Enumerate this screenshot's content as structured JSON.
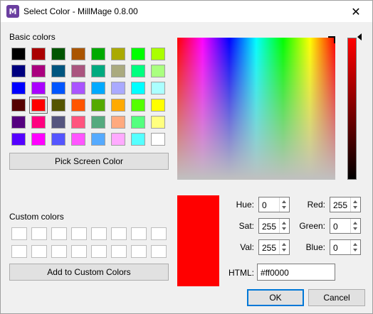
{
  "window": {
    "title": "Select Color - MillMage 0.8.00",
    "app_icon": "millmage-logo-icon",
    "close_glyph": "✕"
  },
  "basic": {
    "label": "Basic colors",
    "colors": [
      "#000000",
      "#aa0000",
      "#005500",
      "#aa5500",
      "#00aa00",
      "#aaaa00",
      "#00ff00",
      "#aaff00",
      "#00007f",
      "#aa007f",
      "#00557f",
      "#aa557f",
      "#00aa7f",
      "#aaaa7f",
      "#00ff7f",
      "#aaff7f",
      "#0000ff",
      "#aa00ff",
      "#0055ff",
      "#aa55ff",
      "#00aaff",
      "#aaaaff",
      "#00ffff",
      "#aaffff",
      "#550000",
      "#ff0000",
      "#555500",
      "#ff5500",
      "#55aa00",
      "#ffaa00",
      "#55ff00",
      "#ffff00",
      "#55007f",
      "#ff007f",
      "#55557f",
      "#ff557f",
      "#55aa7f",
      "#ffaa7f",
      "#55ff7f",
      "#ffff7f",
      "#5500ff",
      "#ff00ff",
      "#5555ff",
      "#ff55ff",
      "#55aaff",
      "#ffaaff",
      "#55ffff",
      "#ffffff"
    ],
    "selected_index": 25
  },
  "pick_button": {
    "label": "Pick Screen Color"
  },
  "custom": {
    "label": "Custom colors",
    "colors": [
      "#ffffff",
      "#ffffff",
      "#ffffff",
      "#ffffff",
      "#ffffff",
      "#ffffff",
      "#ffffff",
      "#ffffff",
      "#ffffff",
      "#ffffff",
      "#ffffff",
      "#ffffff",
      "#ffffff",
      "#ffffff",
      "#ffffff",
      "#ffffff"
    ]
  },
  "add_custom_button": {
    "label": "Add to Custom Colors"
  },
  "current_color": "#ff0000",
  "fields": {
    "hue": {
      "label": "Hue:",
      "value": "0"
    },
    "sat": {
      "label": "Sat:",
      "value": "255"
    },
    "val": {
      "label": "Val:",
      "value": "255"
    },
    "red": {
      "label": "Red:",
      "value": "255"
    },
    "green": {
      "label": "Green:",
      "value": "0"
    },
    "blue": {
      "label": "Blue:",
      "value": "0"
    },
    "html": {
      "label": "HTML:",
      "value": "#ff0000"
    }
  },
  "buttons": {
    "ok": "OK",
    "cancel": "Cancel"
  }
}
